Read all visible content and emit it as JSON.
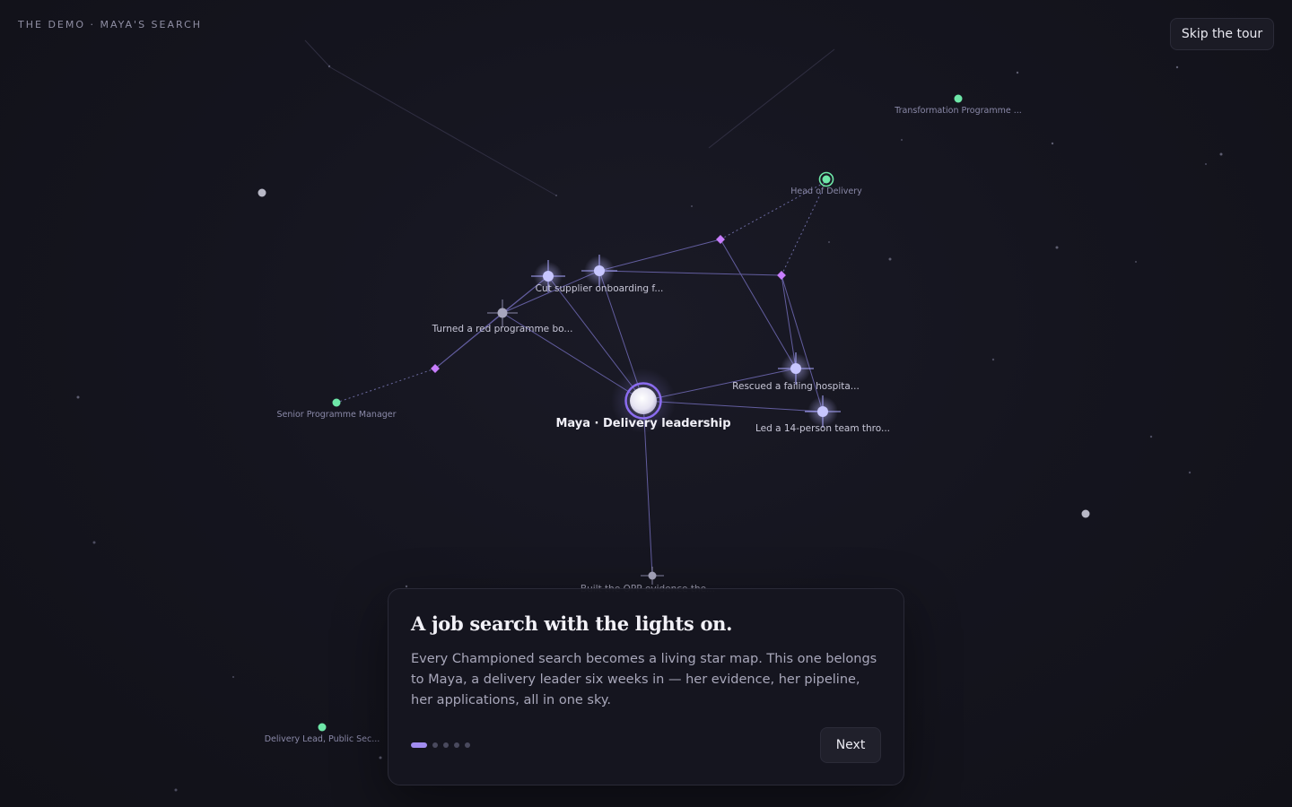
{
  "header": {
    "brand": "THE DEMO · MAYA'S SEARCH",
    "skip_label": "Skip the tour"
  },
  "map": {
    "center": {
      "label": "Maya · Delivery leadership"
    },
    "evidence": [
      {
        "label": "Cut supplier onboarding f..."
      },
      {
        "label": "Turned a red programme bo..."
      },
      {
        "label": "Rescued a failing hospita..."
      },
      {
        "label": "Led a 14-person team thro..."
      },
      {
        "label": "Built the OPP evidence the..."
      }
    ],
    "roles": [
      {
        "label": "Transformation Programme ...",
        "status": "open"
      },
      {
        "label": "Head of Delivery",
        "status": "selected"
      },
      {
        "label": "Senior Programme Manager",
        "status": "open"
      },
      {
        "label": "Delivery Lead, Public Sec...",
        "status": "open"
      }
    ],
    "colors": {
      "background": "#13131c",
      "edge": "#7b74c8",
      "evidence_star": "#c7c6ff",
      "role_dot": "#6ee7a8",
      "application_diamond": "#c77dff",
      "center_ring": "#8b6cf0"
    }
  },
  "tour": {
    "title": "A job search with the lights on.",
    "body": "Every Championed search becomes a living star map. This one belongs to Maya, a delivery leader six weeks in — her evidence, her pipeline, her applications, all in one sky.",
    "step": 1,
    "total_steps": 5,
    "next_label": "Next"
  }
}
